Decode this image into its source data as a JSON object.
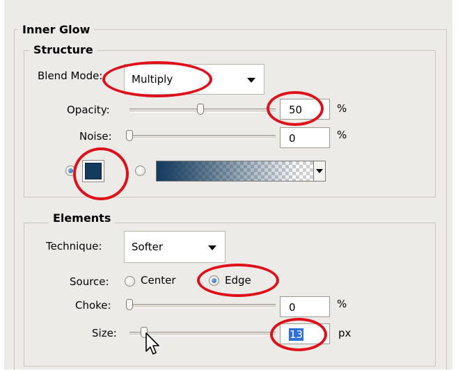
{
  "inner_glow": {
    "title": "Inner Glow"
  },
  "structure": {
    "title": "Structure",
    "blend_mode": {
      "label": "Blend Mode:",
      "value": "Multiply"
    },
    "opacity": {
      "label": "Opacity:",
      "value": "50",
      "unit": "%",
      "slider_fraction": 0.5
    },
    "noise": {
      "label": "Noise:",
      "value": "0",
      "unit": "%",
      "slider_fraction": 0.0
    },
    "glow_color": "#143a5c"
  },
  "elements": {
    "title": "Elements",
    "technique": {
      "label": "Technique:",
      "value": "Softer"
    },
    "source": {
      "label": "Source:",
      "options": [
        "Center",
        "Edge"
      ],
      "selected": "Edge"
    },
    "choke": {
      "label": "Choke:",
      "value": "0",
      "unit": "%",
      "slider_fraction": 0.0
    },
    "size": {
      "label": "Size:",
      "value": "13",
      "unit": "px",
      "slider_fraction": 0.05
    }
  },
  "colors": {
    "highlight": "#e0101a",
    "selection": "#2f6fd6"
  }
}
